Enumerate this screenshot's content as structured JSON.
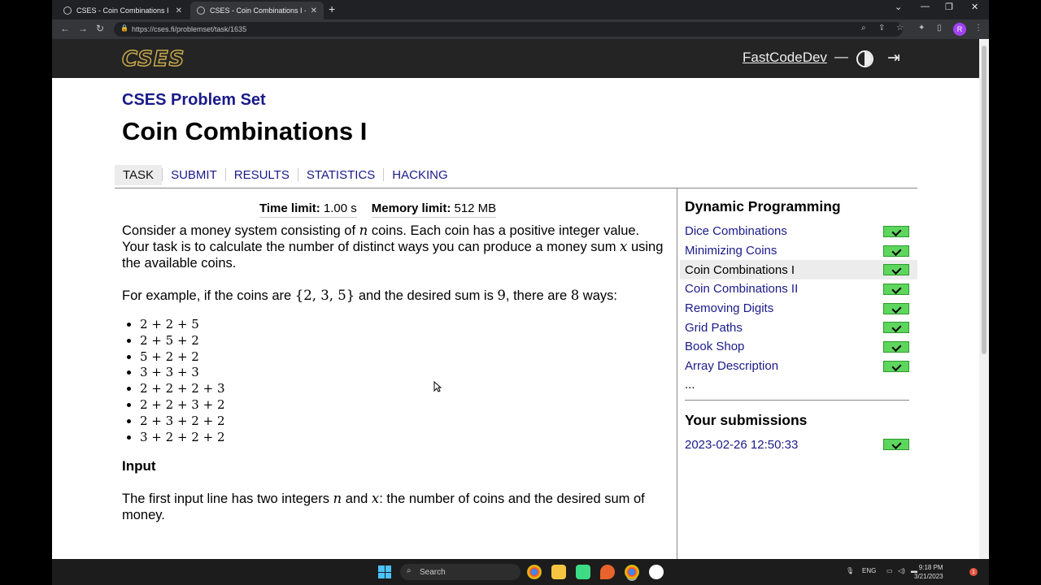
{
  "browser": {
    "tabs": [
      {
        "title": "CSES - Coin Combinations I"
      },
      {
        "title": "CSES - Coin Combinations I - Re..."
      }
    ],
    "url": "https://cses.fi/problemset/task/1635",
    "profile_initial": "R"
  },
  "site": {
    "logo": "CSES",
    "username": "FastCodeDev",
    "dash": "—",
    "logout_symbol": "⇥"
  },
  "problem": {
    "set_title": "CSES Problem Set",
    "title": "Coin Combinations I",
    "tabs": [
      "TASK",
      "SUBMIT",
      "RESULTS",
      "STATISTICS",
      "HACKING"
    ],
    "time_limit_label": "Time limit:",
    "time_limit": "1.00 s",
    "memory_limit_label": "Memory limit:",
    "memory_limit": "512 MB",
    "para1_a": "Consider a money system consisting of ",
    "para1_var": "n",
    "para1_b": " coins. Each coin has a positive integer value. Your task is to calculate the number of distinct ways you can produce a money sum ",
    "para1_var2": "x",
    "para1_c": " using the available coins.",
    "para2_a": "For example, if the coins are ",
    "para2_set": "{2, 3, 5}",
    "para2_b": " and the desired sum is ",
    "para2_sum": "9",
    "para2_c": ", there are ",
    "para2_count": "8",
    "para2_d": " ways:",
    "ways": [
      "2 + 2 + 5",
      "2 + 5 + 2",
      "5 + 2 + 2",
      "3 + 3 + 3",
      "2 + 2 + 2 + 3",
      "2 + 2 + 3 + 2",
      "2 + 3 + 2 + 2",
      "3 + 2 + 2 + 2"
    ],
    "input_heading": "Input",
    "input_a": "The first input line has two integers ",
    "input_var1": "n",
    "input_b": " and ",
    "input_var2": "x",
    "input_c": ": the number of coins and the desired sum of money."
  },
  "sidebar": {
    "section_title": "Dynamic Programming",
    "items": [
      {
        "label": "Dice Combinations"
      },
      {
        "label": "Minimizing Coins"
      },
      {
        "label": "Coin Combinations I"
      },
      {
        "label": "Coin Combinations II"
      },
      {
        "label": "Removing Digits"
      },
      {
        "label": "Grid Paths"
      },
      {
        "label": "Book Shop"
      },
      {
        "label": "Array Description"
      }
    ],
    "more": "...",
    "submissions_title": "Your submissions",
    "submissions": [
      {
        "time": "2023-02-26 12:50:33"
      }
    ]
  },
  "taskbar": {
    "search_placeholder": "Search",
    "lang": "ENG",
    "time": "9:18 PM",
    "date": "3/21/2023",
    "notifications": "1"
  }
}
